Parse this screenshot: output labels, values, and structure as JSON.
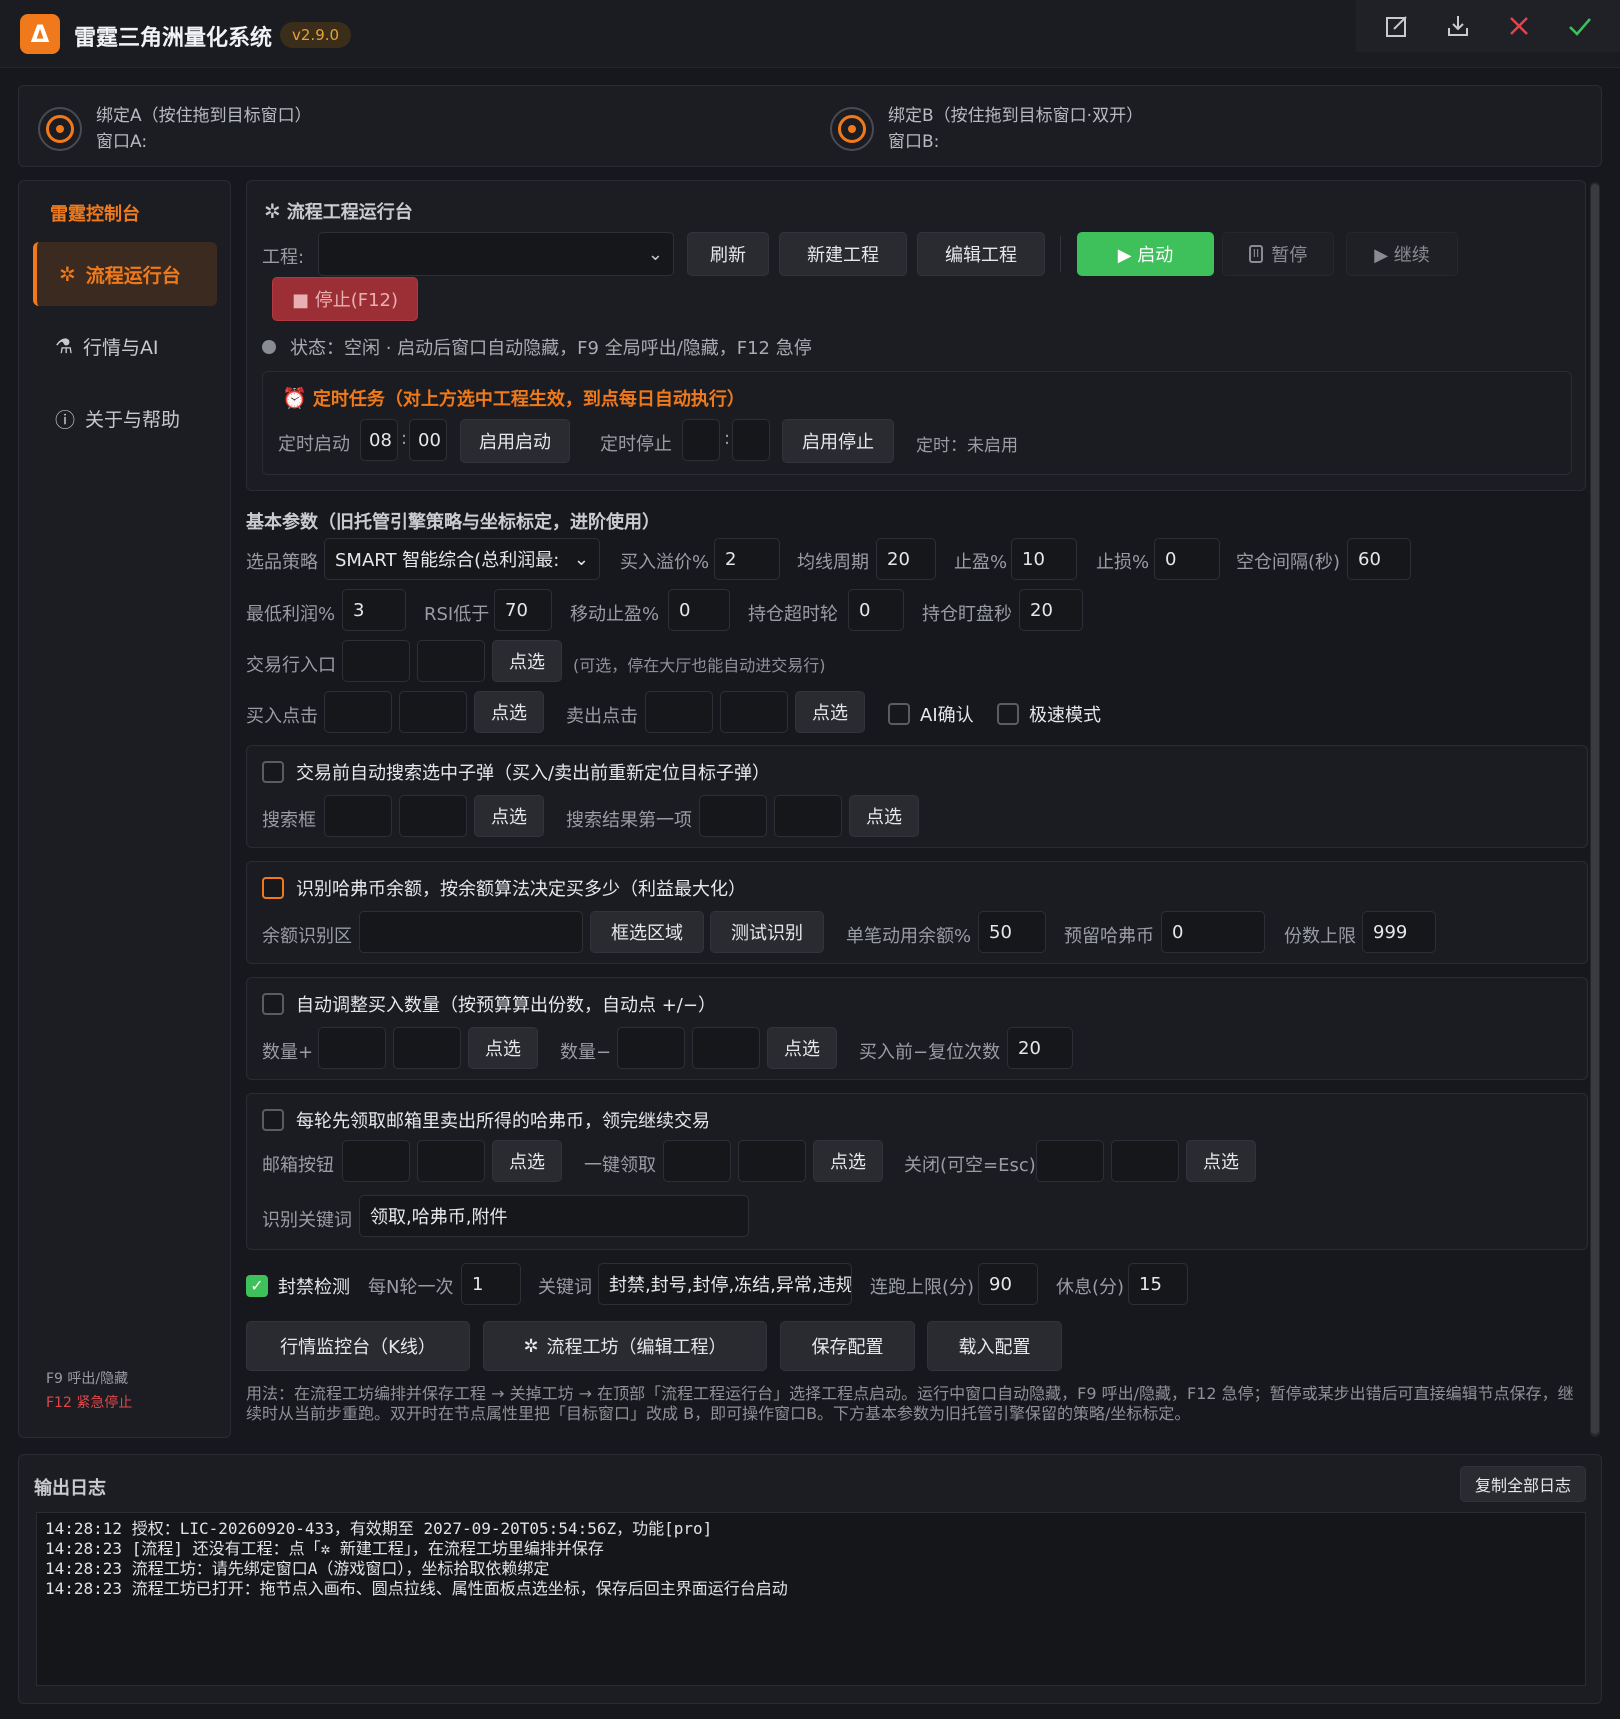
{
  "app": {
    "logo_letter": "Δ",
    "title": "雷霆三角洲量化系统",
    "version": "v2.9.0"
  },
  "titlebar_icons": [
    "edit-icon",
    "download-icon",
    "close-icon",
    "check-icon"
  ],
  "binding": {
    "a_label": "绑定A（按住拖到目标窗口）",
    "a_window": "窗口A:",
    "b_label": "绑定B（按住拖到目标窗口·双开）",
    "b_window": "窗口B:"
  },
  "sidebar": {
    "title": "雷霆控制台",
    "items": [
      {
        "icon": "✲",
        "label": "流程运行台",
        "active": true
      },
      {
        "icon": "⚗",
        "label": "行情与AI",
        "active": false
      },
      {
        "icon": "ⓘ",
        "label": "关于与帮助",
        "active": false
      }
    ],
    "hotkey_f9": "F9 呼出/隐藏",
    "hotkey_f12": "F12 紧急停止"
  },
  "runner": {
    "title": "流程工程运行台",
    "project_label": "工程:",
    "project_value": "",
    "refresh": "刷新",
    "new_project": "新建工程",
    "edit_project": "编辑工程",
    "start": "▶ 启动",
    "pause": "暂停",
    "resume": "▶ 继续",
    "stop": "■ 停止(F12)",
    "status": "状态：空闲 · 启动后窗口自动隐藏，F9 全局呼出/隐藏，F12 急停"
  },
  "schedule": {
    "title": "定时任务（对上方选中工程生效，到点每日自动执行）",
    "start_label": "定时启动",
    "start_hour": "08",
    "start_min": "00",
    "enable_start": "启用启动",
    "stop_label": "定时停止",
    "stop_hour": "",
    "stop_min": "",
    "enable_stop": "启用停止",
    "status": "定时：未启用"
  },
  "basic": {
    "title": "基本参数（旧托管引擎策略与坐标标定，进阶使用）",
    "strategy_label": "选品策略",
    "strategy_value": "SMART 智能综合(总利润最:",
    "buy_premium_label": "买入溢价%",
    "buy_premium": "2",
    "ma_label": "均线周期",
    "ma": "20",
    "tp_label": "止盈%",
    "tp": "10",
    "sl_label": "止损%",
    "sl": "0",
    "idle_label": "空仓间隔(秒)",
    "idle": "60",
    "min_profit_label": "最低利润%",
    "min_profit": "3",
    "rsi_label": "RSI低于",
    "rsi": "70",
    "trail_label": "移动止盈%",
    "trail": "0",
    "hold_label": "持仓超时轮",
    "hold": "0",
    "watch_label": "持仓盯盘秒",
    "watch": "20",
    "entry_label": "交易行入口",
    "pick": "点选",
    "entry_hint": "(可选，停在大厅也能自动进交易行)",
    "buy_click_label": "买入点击",
    "sell_click_label": "卖出点击",
    "ai_confirm": "AI确认",
    "fast_mode": "极速模式"
  },
  "search_box": {
    "title": "交易前自动搜索选中子弹（买入/卖出前重新定位目标子弹）",
    "search_label": "搜索框",
    "first_result_label": "搜索结果第一项"
  },
  "balance_box": {
    "title": "识别哈弗币余额，按余额算法决定买多少（利益最大化）",
    "area_label": "余额识别区",
    "select_area": "框选区域",
    "test": "测试识别",
    "use_pct_label": "单笔动用余额%",
    "use_pct": "50",
    "reserve_label": "预留哈弗币",
    "reserve": "0",
    "max_label": "份数上限",
    "max": "999"
  },
  "qty_box": {
    "title": "自动调整买入数量（按预算算出份数，自动点 +/−）",
    "plus_label": "数量+",
    "minus_label": "数量−",
    "reset_label": "买入前−复位次数",
    "reset": "20"
  },
  "mail_box": {
    "title": "每轮先领取邮箱里卖出所得的哈弗币，领完继续交易",
    "mail_label": "邮箱按钮",
    "claim_label": "一键领取",
    "close_label": "关闭(可空=Esc)",
    "keyword_label": "识别关键词",
    "keyword": "领取,哈弗币,附件"
  },
  "ban": {
    "label": "封禁检测",
    "every_label": "每N轮一次",
    "every": "1",
    "kw_label": "关键词",
    "kw": "封禁,封号,封停,冻结,异常,违规",
    "limit_label": "连跑上限(分)",
    "limit": "90",
    "rest_label": "休息(分)",
    "rest": "15"
  },
  "actions": {
    "market": "行情监控台（K线）",
    "workshop": "流程工坊（编辑工程）",
    "save": "保存配置",
    "load": "载入配置"
  },
  "usage": "用法：在流程工坊编排并保存工程 → 关掉工坊 → 在顶部「流程工程运行台」选择工程点启动。运行中窗口自动隐藏，F9 呼出/隐藏，F12 急停；暂停或某步出错后可直接编辑节点保存，继续时从当前步重跑。双开时在节点属性里把「目标窗口」改成 B，即可操作窗口B。下方基本参数为旧托管引擎保留的策略/坐标标定。",
  "log": {
    "title": "输出日志",
    "copy": "复制全部日志",
    "lines": [
      "14:28:12 授权：LIC-20260920-433，有效期至 2027-09-20T05:54:56Z，功能[pro]",
      "14:28:23 [流程] 还没有工程：点「✲ 新建工程」，在流程工坊里编排并保存",
      "14:28:23 流程工坊：请先绑定窗口A（游戏窗口），坐标拾取依赖绑定",
      "14:28:23 流程工坊已打开：拖节点入画布、圆点拉线、属性面板点选坐标，保存后回主界面运行台启动"
    ]
  },
  "colors": {
    "accent": "#f07a1b",
    "start_green": "#3ec05a",
    "stop_red": "#9c2f35",
    "bg": "#17181d"
  }
}
